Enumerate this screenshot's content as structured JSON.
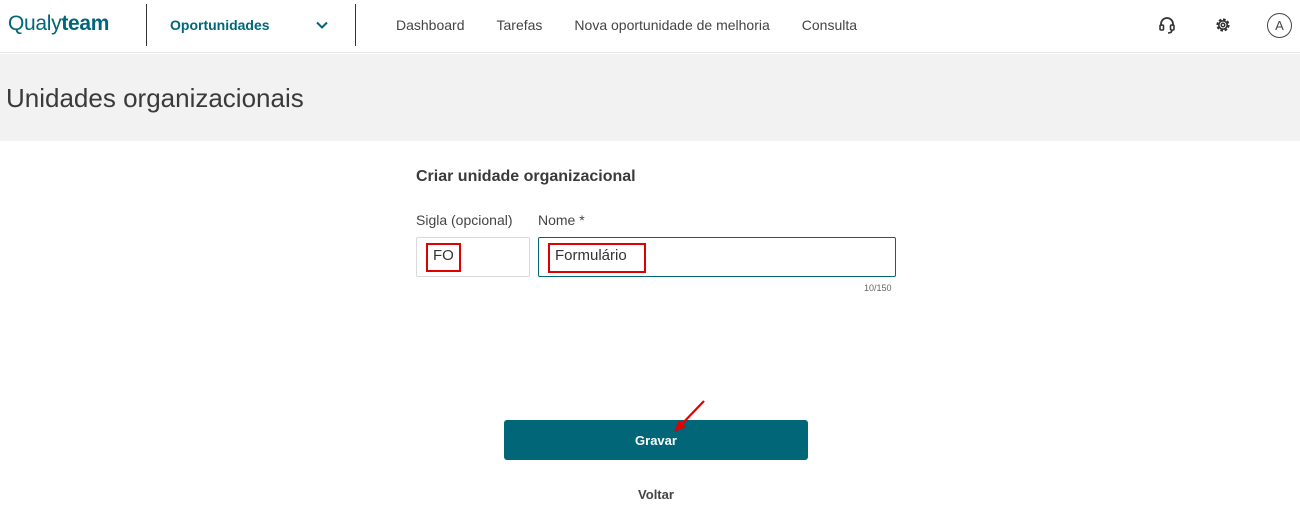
{
  "app": {
    "logo_light": "Qualy",
    "logo_bold": "team"
  },
  "module_selector": {
    "label": "Oportunidades"
  },
  "nav": [
    "Dashboard",
    "Tarefas",
    "Nova oportunidade de melhoria",
    "Consulta"
  ],
  "header_icons": {
    "support": "headset-icon",
    "settings": "gear-icon",
    "avatar_letter": "A"
  },
  "page": {
    "title": "Unidades organizacionais"
  },
  "form": {
    "title": "Criar unidade organizacional",
    "sigla_label": "Sigla (opcional)",
    "sigla_value": "FO",
    "nome_label": "Nome *",
    "nome_value": "Formulário",
    "nome_counter": "10/150"
  },
  "actions": {
    "save": "Gravar",
    "back": "Voltar"
  },
  "colors": {
    "brand": "#006678",
    "highlight": "#e00000"
  }
}
